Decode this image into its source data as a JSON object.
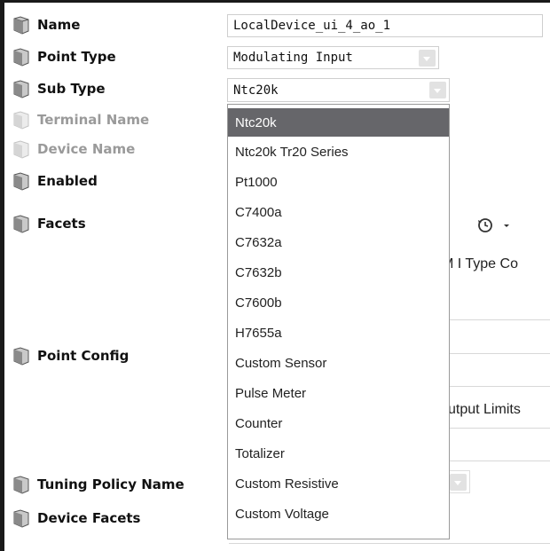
{
  "properties": [
    {
      "label": "Name",
      "enabled": true
    },
    {
      "label": "Point Type",
      "enabled": true
    },
    {
      "label": "Sub Type",
      "enabled": true
    },
    {
      "label": "Terminal Name",
      "enabled": false
    },
    {
      "label": "Device Name",
      "enabled": false
    },
    {
      "label": "Enabled",
      "enabled": true
    },
    {
      "label": "Facets",
      "enabled": true
    },
    {
      "label": "Point Config",
      "enabled": true
    },
    {
      "label": "Tuning Policy Name",
      "enabled": true
    },
    {
      "label": "Device Facets",
      "enabled": true
    }
  ],
  "fields": {
    "name_value": "LocalDevice_ui_4_ao_1",
    "point_type_value": "Modulating Input",
    "sub_type_value": "Ntc20k"
  },
  "dropdown": {
    "selected": "Ntc20k",
    "options": [
      "Ntc20k",
      "Ntc20k Tr20 Series",
      "Pt1000",
      "C7400a",
      "C7632a",
      "C7632b",
      "C7600b",
      "H7655a",
      "Custom Sensor",
      "Pulse Meter",
      "Counter",
      "Totalizer",
      "Custom Resistive",
      "Custom Voltage"
    ]
  },
  "partial_text": {
    "mi_type": "M I Type Co",
    "output_limits": "utput Limits"
  },
  "icons": {
    "property": "object-icon",
    "history": "history-icon"
  }
}
